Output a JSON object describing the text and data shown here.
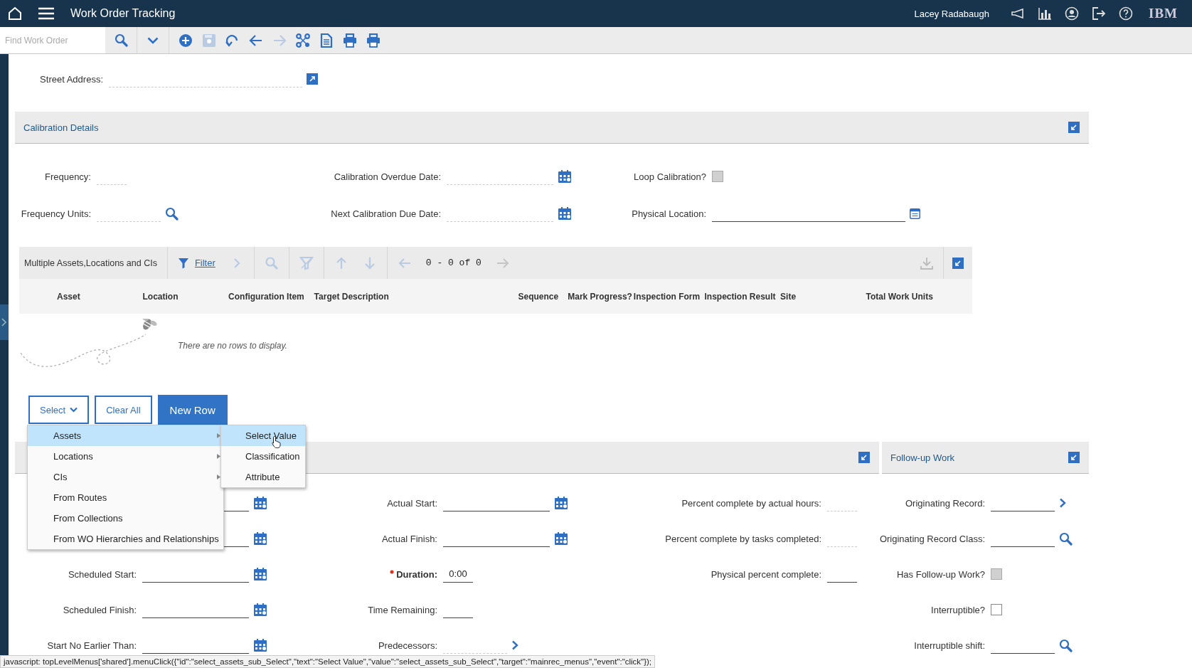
{
  "header": {
    "title": "Work Order Tracking",
    "user": "Lacey Radabaugh",
    "brand": "IBM"
  },
  "toolbar": {
    "search": {
      "placeholder": "Find Work Order"
    },
    "buttons": [
      {
        "kind": "add",
        "disabled": false
      },
      {
        "kind": "save",
        "disabled": true
      },
      {
        "kind": "undo",
        "disabled": false
      },
      {
        "kind": "back",
        "disabled": false
      },
      {
        "kind": "forward",
        "disabled": true
      },
      {
        "kind": "workflow",
        "disabled": false
      },
      {
        "kind": "document",
        "disabled": false
      },
      {
        "kind": "print",
        "disabled": false
      },
      {
        "kind": "print",
        "disabled": false
      }
    ]
  },
  "street_address": {
    "label": "Street Address:",
    "kind": "link",
    "readonly": true
  },
  "calibration": {
    "title": "Calibration Details",
    "columns": [
      [
        {
          "label": "Frequency:",
          "kind": "text",
          "readonly": true
        },
        {
          "label": "Frequency Units:",
          "kind": "lookup",
          "readonly": true
        }
      ],
      [
        {
          "label": "Calibration Overdue Date:",
          "kind": "date",
          "readonly": true
        },
        {
          "label": "Next Calibration Due Date:",
          "kind": "date",
          "readonly": true
        }
      ],
      [
        {
          "label": "Loop Calibration?",
          "kind": "checkbox",
          "checked": false,
          "disabled": true
        },
        {
          "label": "Physical Location:",
          "kind": "detail",
          "readonly": false
        }
      ]
    ]
  },
  "assets_table": {
    "title": "Multiple Assets,Locations and CIs",
    "filter": "Filter",
    "pager": "0 - 0 of 0",
    "tools": [
      {
        "kind": "next",
        "disabled": true
      },
      {
        "kind": "search",
        "disabled": true
      },
      {
        "kind": "clear_filter",
        "disabled": true
      },
      {
        "kind": "up",
        "disabled": true
      },
      {
        "kind": "down",
        "disabled": true
      },
      {
        "kind": "prev",
        "disabled": true
      }
    ],
    "columns": [
      "Asset",
      "Location",
      "Configuration Item",
      "Target Description",
      "Sequence",
      "Mark Progress?",
      "Inspection Form",
      "Inspection Result",
      "Site",
      "Total Work Units"
    ],
    "empty_message": "There are no rows to display."
  },
  "buttons": [
    {
      "label": "Select",
      "kind": "dropdown"
    },
    {
      "label": "Clear All",
      "kind": "secondary"
    },
    {
      "label": "New Row",
      "kind": "primary"
    }
  ],
  "select_menu": {
    "items": [
      {
        "label": "Assets",
        "submenu": true,
        "selected": true
      },
      {
        "label": "Locations",
        "submenu": true,
        "selected": false
      },
      {
        "label": "CIs",
        "submenu": true,
        "selected": false
      },
      {
        "label": "From Routes",
        "submenu": false,
        "selected": false
      },
      {
        "label": "From Collections",
        "submenu": false,
        "selected": false
      },
      {
        "label": "From WO Hierarchies and Relationships",
        "submenu": false,
        "selected": false
      }
    ],
    "submenu": [
      {
        "label": "Select Value",
        "selected": true
      },
      {
        "label": "Classification",
        "selected": false
      },
      {
        "label": "Attribute",
        "selected": false
      }
    ]
  },
  "dates_section": {
    "columns": [
      [
        {
          "kind": "date",
          "readonly": false
        },
        {
          "kind": "date",
          "readonly": false
        },
        {
          "label": "Scheduled Start:",
          "kind": "date",
          "readonly": false
        },
        {
          "label": "Scheduled Finish:",
          "kind": "date",
          "readonly": false
        },
        {
          "label": "Start No Earlier Than:",
          "kind": "date",
          "readonly": false
        }
      ],
      [
        {
          "label": "Actual Start:",
          "kind": "date",
          "readonly": false
        },
        {
          "label": "Actual Finish:",
          "kind": "date",
          "readonly": false
        },
        {
          "label": "Duration:",
          "kind": "text",
          "readonly": false,
          "required": true,
          "value": "0:00"
        },
        {
          "label": "Time Remaining:",
          "kind": "text",
          "readonly": false
        },
        {
          "label": "Predecessors:",
          "kind": "goto",
          "readonly": true
        }
      ],
      [
        {
          "label": "Percent complete by actual hours:",
          "kind": "text",
          "readonly": true
        },
        {
          "label": "Percent complete by tasks completed:",
          "kind": "text",
          "readonly": true
        },
        {
          "label": "Physical percent complete:",
          "kind": "text",
          "readonly": false
        }
      ]
    ]
  },
  "follow_up": {
    "title": "Follow-up Work",
    "fields": [
      {
        "label": "Originating Record:",
        "kind": "goto",
        "readonly": false
      },
      {
        "label": "Originating Record Class:",
        "kind": "lookup",
        "readonly": false
      },
      {
        "label": "Has Follow-up Work?",
        "kind": "checkbox",
        "checked": false,
        "disabled": true
      },
      {
        "label": "Interruptible?",
        "kind": "checkbox",
        "checked": false,
        "disabled": false
      },
      {
        "label": "Interruptible shift:",
        "kind": "lookup",
        "readonly": false
      }
    ]
  },
  "status_bar": "javascript: topLevelMenus['shared'].menuClick({\"id\":\"select_assets_sub_Select\",\"text\":\"Select Value\",\"value\":\"select_assets_sub_Select\",\"target\":\"mainrec_menus\",\"event\":\"click\"});"
}
